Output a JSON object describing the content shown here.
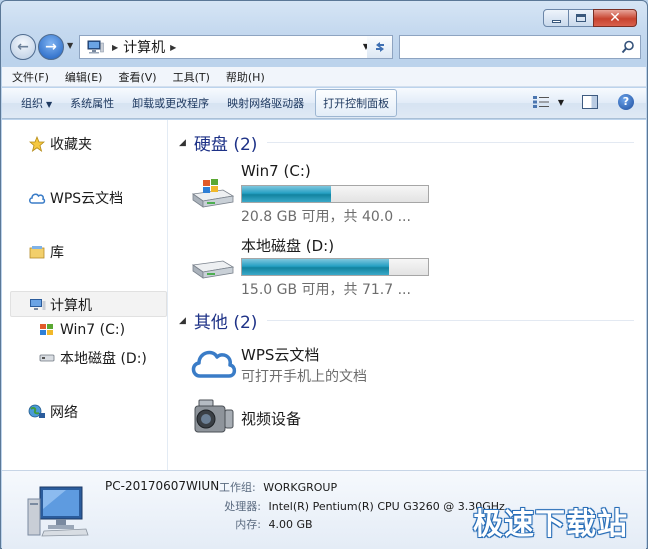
{
  "window": {
    "caption_buttons": {
      "minimize_icon": "minimize-icon",
      "maximize_icon": "maximize-icon",
      "close_icon": "close-icon"
    }
  },
  "nav": {
    "address": {
      "icon": "computer-icon",
      "path": "计算机"
    },
    "search": {
      "value": "",
      "placeholder": ""
    }
  },
  "menu": [
    "文件(F)",
    "编辑(E)",
    "查看(V)",
    "工具(T)",
    "帮助(H)"
  ],
  "toolbar": {
    "organize": "组织",
    "system_properties": "系统属性",
    "uninstall": "卸载或更改程序",
    "map_drive": "映射网络驱动器",
    "control_panel": "打开控制面板"
  },
  "sidebar": {
    "favorites": "收藏夹",
    "wps_cloud": "WPS云文档",
    "libraries": "库",
    "computer": "计算机",
    "drive_c": "Win7 (C:)",
    "drive_d": "本地磁盘 (D:)",
    "network": "网络"
  },
  "main": {
    "hard_drives_header": "硬盘 (2)",
    "drives": [
      {
        "name": "Win7 (C:)",
        "free_text": "20.8 GB 可用，共 40.0 ...",
        "used_fraction": 0.48
      },
      {
        "name": "本地磁盘 (D:)",
        "free_text": "15.0 GB 可用，共 71.7 ...",
        "used_fraction": 0.79
      }
    ],
    "other_header": "其他 (2)",
    "other_items": [
      {
        "name": "WPS云文档",
        "subtitle": "可打开手机上的文档"
      },
      {
        "name": "视频设备"
      }
    ]
  },
  "details": {
    "computer_name": "PC-20170607WIUN",
    "workgroup_label": "工作组:",
    "workgroup_value": "WORKGROUP",
    "processor_label": "处理器:",
    "processor_value": "Intel(R) Pentium(R) CPU G3260 @ 3.30GHz",
    "memory_label": "内存:",
    "memory_value": "4.00 GB"
  },
  "watermark": "极速下载站",
  "colors": {
    "accent": "#1e3287",
    "drive_fill": "#26a0c3",
    "window_frame": "#bcd3ec"
  }
}
